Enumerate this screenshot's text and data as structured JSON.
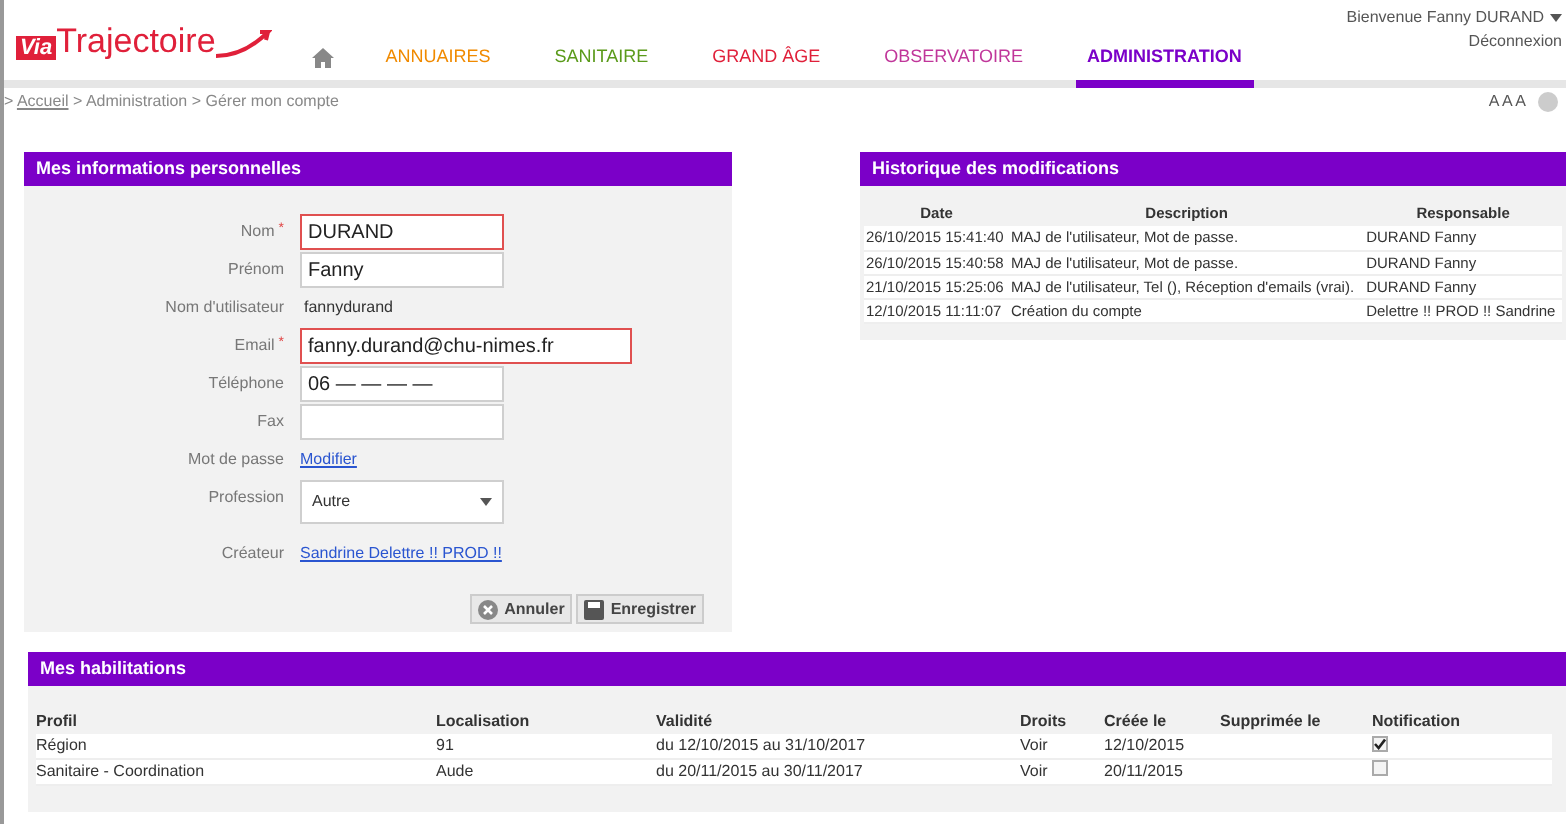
{
  "header": {
    "logo": {
      "prefix": "Via",
      "name": "Trajectoire"
    },
    "welcome": "Bienvenue Fanny DURAND",
    "logout": "Déconnexion",
    "nav": [
      {
        "label": "ANNUAIRES",
        "color": "#f08a00",
        "selected": false
      },
      {
        "label": "SANITAIRE",
        "color": "#5a9a1a",
        "selected": false
      },
      {
        "label": "GRAND ÂGE",
        "color": "#e0203a",
        "selected": false
      },
      {
        "label": "OBSERVATOIRE",
        "color": "#c0369a",
        "selected": false
      },
      {
        "label": "ADMINISTRATION",
        "color": "#7b00c8",
        "selected": true
      }
    ]
  },
  "breadcrumb": {
    "prefix": ">",
    "items": [
      {
        "label": "Accueil",
        "kind": "link"
      },
      {
        "label": "Administration",
        "kind": "text"
      },
      {
        "label": "Gérer mon compte",
        "kind": "text"
      }
    ],
    "separator": ">"
  },
  "font_size_control": "A A A",
  "personal_info": {
    "title": "Mes informations personnelles",
    "fields": [
      {
        "kind": "input",
        "label": "Nom",
        "required_mark": "*",
        "value": "DURAND",
        "invalid": true,
        "wide": false
      },
      {
        "kind": "input",
        "label": "Prénom",
        "value": "Fanny",
        "invalid": false,
        "wide": false
      },
      {
        "kind": "static",
        "label": "Nom d'utilisateur",
        "value": "fannydurand"
      },
      {
        "kind": "input",
        "label": "Email",
        "required_mark": "*",
        "value": "fanny.durand@chu-nimes.fr",
        "invalid": true,
        "wide": true
      },
      {
        "kind": "input",
        "label": "Téléphone",
        "value": "06 — — — —",
        "invalid": false,
        "wide": false
      },
      {
        "kind": "input",
        "label": "Fax",
        "invalid": false,
        "wide": false
      },
      {
        "kind": "link",
        "label": "Mot de passe",
        "value": "Modifier"
      },
      {
        "kind": "select",
        "label": "Profession",
        "value": "Autre"
      },
      {
        "kind": "link",
        "label": "Créateur",
        "value": "Sandrine Delettre !! PROD !!"
      }
    ],
    "buttons": [
      {
        "label": "Annuler",
        "kind": "cancel"
      },
      {
        "label": "Enregistrer",
        "kind": "save"
      }
    ]
  },
  "history": {
    "title": "Historique des modifications",
    "columns": [
      "Date",
      "Description",
      "Responsable"
    ],
    "rows": [
      [
        "26/10/2015 15:41:40",
        "MAJ de l'utilisateur, Mot de passe.",
        "DURAND Fanny"
      ],
      [
        "26/10/2015 15:40:58",
        "MAJ de l'utilisateur, Mot de passe.",
        "DURAND Fanny"
      ],
      [
        "21/10/2015 15:25:06",
        "MAJ de l'utilisateur, Tel (), Réception d'emails (vrai).",
        "DURAND Fanny"
      ],
      [
        "12/10/2015 11:11:07",
        "Création du compte",
        "Delettre !! PROD !! Sandrine"
      ]
    ]
  },
  "habilitations": {
    "title": "Mes habilitations",
    "columns": [
      "Profil",
      "Localisation",
      "Validité",
      "Droits",
      "Créée le",
      "Supprimée le",
      "Notification"
    ],
    "rows": [
      {
        "cells": [
          "Région",
          "91",
          "du 12/10/2015 au 31/10/2017",
          "Voir",
          "12/10/2015"
        ],
        "notification": true
      },
      {
        "cells": [
          "Sanitaire - Coordination",
          "Aude",
          "du 20/11/2015 au 30/11/2017",
          "Voir",
          "20/11/2015"
        ],
        "notification": false
      }
    ]
  }
}
